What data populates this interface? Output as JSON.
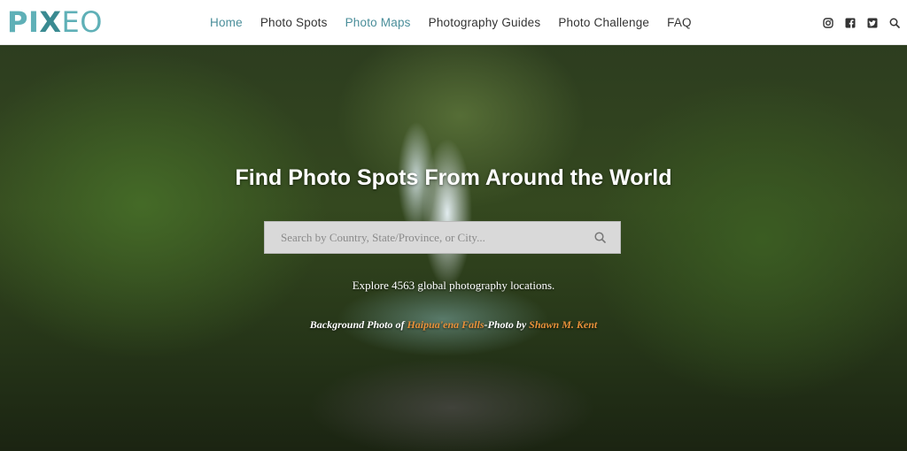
{
  "logo": {
    "part1": "PI",
    "part2": "X",
    "part3": "EO"
  },
  "nav": {
    "items": [
      "Home",
      "Photo Spots",
      "Photo Maps",
      "Photography Guides",
      "Photo Challenge",
      "FAQ"
    ]
  },
  "social": {
    "icons": [
      "instagram-icon",
      "facebook-icon",
      "twitter-icon",
      "search-icon"
    ]
  },
  "hero": {
    "title": "Find Photo Spots From Around the World",
    "search_placeholder": "Search by Country, State/Province, or City...",
    "explore_text": "Explore 4563 global photography locations.",
    "credit_prefix": "Background Photo of ",
    "credit_place": "Haipua'ena Falls",
    "credit_middle": "-Photo by ",
    "credit_author": "Shawn M. Kent"
  },
  "colors": {
    "accent_teal": "#4a8e9a",
    "logo_teal": "#5fb0b7",
    "credit_orange": "#e8913a"
  }
}
